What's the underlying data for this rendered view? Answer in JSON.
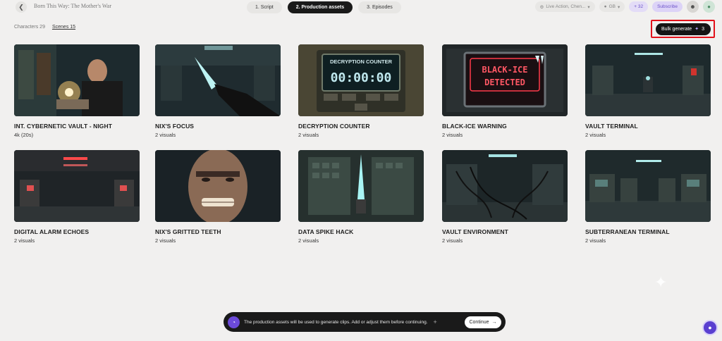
{
  "header": {
    "back_icon": "chevron-left-icon",
    "project_title": "Born This Way: The Mother's War",
    "steps": [
      {
        "label": "1. Script",
        "active": false
      },
      {
        "label": "2. Production assets",
        "active": true
      },
      {
        "label": "3. Episodes",
        "active": false
      }
    ],
    "style_chip": "Live Action, Chen...",
    "storage_chip": "GB",
    "credits": "+ 32",
    "subscribe": "Subscribe"
  },
  "subtabs": [
    {
      "label": "Characters 29",
      "active": false
    },
    {
      "label": "Scenes 15",
      "active": true
    }
  ],
  "bulk_generate": {
    "label": "Bulk generate",
    "count": "3",
    "icon": "sparkle-icon"
  },
  "scenes": [
    {
      "title": "INT. CYBERNETIC VAULT - NIGHT",
      "sub": "4k (20s)"
    },
    {
      "title": "NIX'S FOCUS",
      "sub": "2 visuals"
    },
    {
      "title": "DECRYPTION COUNTER",
      "sub": "2 visuals",
      "screen_title": "DECRYPTION COUNTER",
      "screen_value": "00:00:00"
    },
    {
      "title": "BLACK-ICE WARNING",
      "sub": "2 visuals",
      "screen_line1": "BLACK-ICE",
      "screen_line2": "DETECTED"
    },
    {
      "title": "VAULT TERMINAL",
      "sub": "2 visuals"
    },
    {
      "title": "DIGITAL ALARM ECHOES",
      "sub": "2 visuals"
    },
    {
      "title": "NIX'S GRITTED TEETH",
      "sub": "2 visuals"
    },
    {
      "title": "DATA SPIKE HACK",
      "sub": "2 visuals"
    },
    {
      "title": "VAULT ENVIRONMENT",
      "sub": "2 visuals"
    },
    {
      "title": "SUBTERRANEAN TERMINAL",
      "sub": "2 visuals"
    }
  ],
  "banner": {
    "text": "The production assets will be used to generate clips. Add or adjust them before continuing.",
    "continue": "Continue",
    "continue_icon": "arrow-right-icon"
  },
  "colors": {
    "accent": "#6c4ad9",
    "highlight_box": "#e3121b"
  }
}
